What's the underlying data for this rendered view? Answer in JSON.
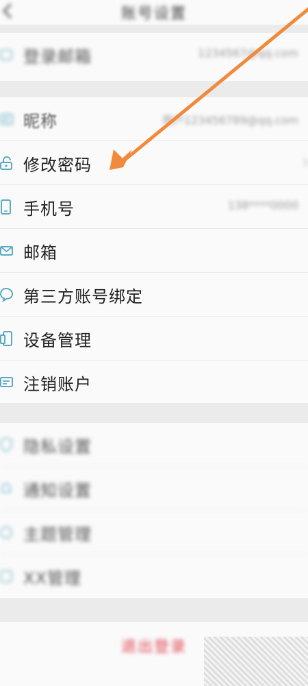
{
  "header": {
    "title": "账号设置",
    "back_icon": "chevron-left-icon"
  },
  "top_row": {
    "label": "登录邮箱",
    "value": "1234567@qq.com"
  },
  "account_rows": [
    {
      "label": "昵称",
      "value": "用户123456789@qq.com",
      "icon": "id-card-icon"
    },
    {
      "label": "修改密码",
      "value": "",
      "icon": "lock-icon"
    },
    {
      "label": "手机号",
      "value": "138****0000",
      "icon": "phone-icon"
    },
    {
      "label": "邮箱",
      "value": "",
      "icon": "mail-icon"
    },
    {
      "label": "第三方账号绑定",
      "value": "",
      "icon": "chat-bubble-icon"
    },
    {
      "label": "设备管理",
      "value": "",
      "icon": "device-icon"
    },
    {
      "label": "注销账户",
      "value": "",
      "icon": "close-account-icon"
    }
  ],
  "other_rows": [
    {
      "label": "隐私设置",
      "icon": "shield-icon"
    },
    {
      "label": "通知设置",
      "icon": "bell-icon"
    },
    {
      "label": "主题管理",
      "icon": "theme-icon"
    },
    {
      "label": "XX管理",
      "icon": "manage-icon"
    }
  ],
  "logout": {
    "label": "退出登录"
  },
  "annotation": {
    "arrow_color": "#f08a3c"
  }
}
